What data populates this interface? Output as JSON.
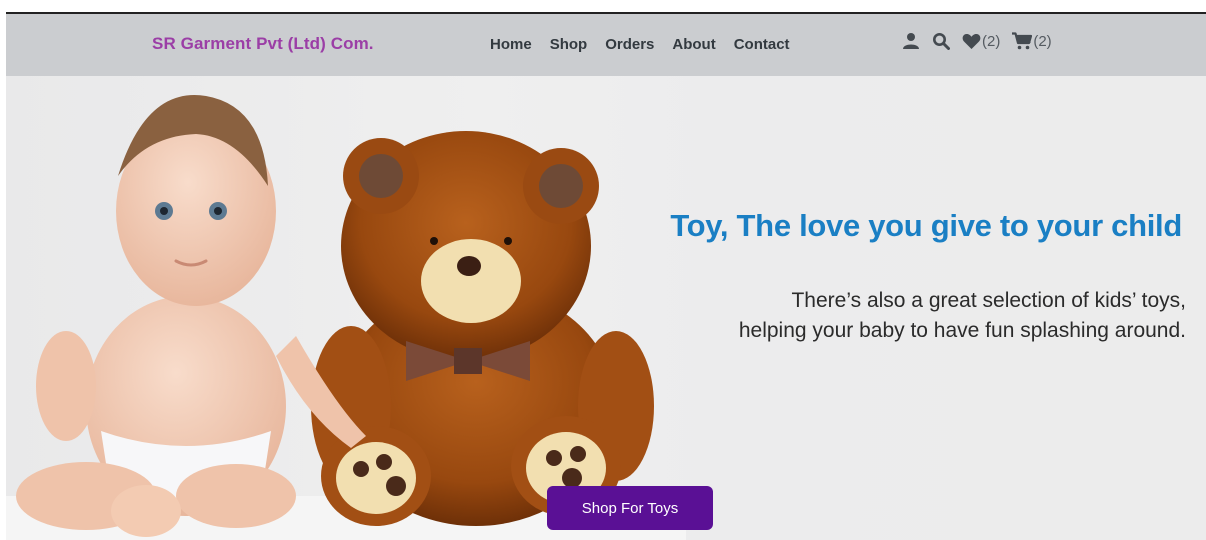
{
  "brand": {
    "name": "SR Garment Pvt (Ltd) Com."
  },
  "nav": {
    "links": [
      "Home",
      "Shop",
      "Orders",
      "About",
      "Contact"
    ]
  },
  "header_icons": {
    "user": "user-icon",
    "search": "search-icon",
    "wishlist": {
      "icon": "heart-icon",
      "count": "(2)"
    },
    "cart": {
      "icon": "cart-icon",
      "count": "(2)"
    }
  },
  "hero": {
    "headline": "Toy, The love you give to your child",
    "subtext_line1": "There’s also a great selection of kids’ toys,",
    "subtext_line2": "helping your baby to have fun splashing around.",
    "cta": "Shop For Toys"
  },
  "colors": {
    "brand": "#9b3ea6",
    "navbar_bg": "#cbcdd0",
    "headline": "#1a7fc4",
    "cta_bg": "#5a1095"
  }
}
